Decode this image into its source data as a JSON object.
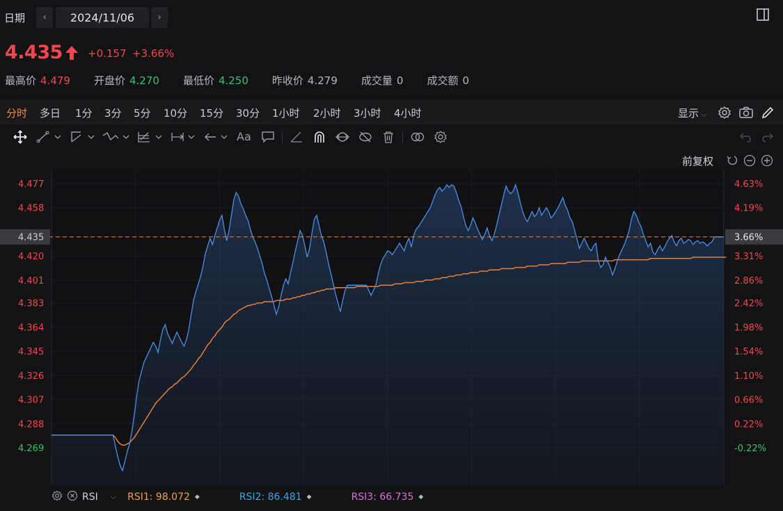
{
  "header": {
    "date_label": "日期",
    "date_value": "2024/11/06",
    "prev_label": "‹",
    "next_label": "›"
  },
  "quote": {
    "price": "4.435",
    "change": "+0.157",
    "change_pct": "+3.66%",
    "stats": [
      {
        "label": "最高价",
        "value": "4.479",
        "color": "red"
      },
      {
        "label": "开盘价",
        "value": "4.270",
        "color": "green"
      },
      {
        "label": "最低价",
        "value": "4.250",
        "color": "green"
      },
      {
        "label": "昨收价",
        "value": "4.279",
        "color": "neutral"
      },
      {
        "label": "成交量",
        "value": "0",
        "color": "neutral"
      },
      {
        "label": "成交额",
        "value": "0",
        "color": "neutral"
      }
    ]
  },
  "timeframes": [
    "分时",
    "多日",
    "1分",
    "3分",
    "5分",
    "10分",
    "15分",
    "30分",
    "1小时",
    "2小时",
    "3小时",
    "4小时"
  ],
  "active_timeframe": "分时",
  "toolbar_right": {
    "display_label": "显示"
  },
  "adjust_label": "前复权",
  "rsi": {
    "name": "RSI",
    "rsi1": "RSI1: 98.072",
    "rsi2": "RSI2: 86.481",
    "rsi3": "RSI3: 66.735",
    "rsi1_color": "#f0a04a",
    "rsi2_color": "#3aa6e8",
    "rsi3_color": "#d872d8"
  },
  "colors": {
    "up": "#f0484e",
    "down": "#36c46b",
    "price_line": "#4a90e8",
    "avg_line": "#e8803a",
    "accent": "#f08a3a"
  },
  "chart_data": {
    "type": "line",
    "prev_close": 4.279,
    "current": 4.435,
    "ylim": [
      4.25,
      4.48
    ],
    "left_ticks": [
      "4.477",
      "4.458",
      "4.435",
      "4.420",
      "4.401",
      "4.383",
      "4.364",
      "4.345",
      "4.326",
      "4.307",
      "4.288",
      "4.269"
    ],
    "left_tick_values": [
      4.477,
      4.458,
      4.435,
      4.42,
      4.401,
      4.383,
      4.364,
      4.345,
      4.326,
      4.307,
      4.288,
      4.269
    ],
    "right_ticks": [
      "4.63%",
      "4.19%",
      "3.66%",
      "3.31%",
      "2.86%",
      "2.42%",
      "1.98%",
      "1.54%",
      "1.10%",
      "0.66%",
      "0.22%",
      "-0.22%"
    ],
    "highlight_value": "4.435",
    "highlight_pct": "3.66%",
    "series": [
      {
        "name": "price",
        "values": [
          4.279,
          4.279,
          4.279,
          4.279,
          4.279,
          4.279,
          4.279,
          4.279,
          4.279,
          4.279,
          4.279,
          4.279,
          4.279,
          4.279,
          4.279,
          4.279,
          4.279,
          4.279,
          4.279,
          4.279,
          4.279,
          4.279,
          4.279,
          4.279,
          4.279,
          4.279,
          4.279,
          4.27,
          4.262,
          4.255,
          4.251,
          4.258,
          4.266,
          4.272,
          4.282,
          4.295,
          4.31,
          4.322,
          4.329,
          4.336,
          4.34,
          4.344,
          4.348,
          4.352,
          4.349,
          4.344,
          4.354,
          4.362,
          4.366,
          4.359,
          4.355,
          4.351,
          4.356,
          4.36,
          4.356,
          4.352,
          4.349,
          4.354,
          4.362,
          4.374,
          4.385,
          4.392,
          4.398,
          4.404,
          4.412,
          4.422,
          4.428,
          4.434,
          4.429,
          4.436,
          4.442,
          4.448,
          4.452,
          4.441,
          4.432,
          4.44,
          4.452,
          4.464,
          4.47,
          4.467,
          4.461,
          4.457,
          4.452,
          4.448,
          4.441,
          4.435,
          4.431,
          4.426,
          4.42,
          4.414,
          4.406,
          4.401,
          4.394,
          4.388,
          4.381,
          4.374,
          4.38,
          4.389,
          4.397,
          4.402,
          4.398,
          4.407,
          4.415,
          4.424,
          4.432,
          4.44,
          4.436,
          4.428,
          4.419,
          4.426,
          4.438,
          4.449,
          4.452,
          4.444,
          4.436,
          4.431,
          4.423,
          4.414,
          4.406,
          4.398,
          4.39,
          4.383,
          4.376,
          4.385,
          4.393,
          4.397,
          4.397,
          4.397,
          4.397,
          4.397,
          4.397,
          4.397,
          4.397,
          4.397,
          4.393,
          4.389,
          4.393,
          4.397,
          4.406,
          4.413,
          4.418,
          4.421,
          4.424,
          4.423,
          4.421,
          4.424,
          4.427,
          4.43,
          4.427,
          4.424,
          4.43,
          4.434,
          4.427,
          4.436,
          4.441,
          4.443,
          4.446,
          4.449,
          4.452,
          4.455,
          4.458,
          4.463,
          4.468,
          4.472,
          4.474,
          4.471,
          4.473,
          4.476,
          4.474,
          4.476,
          4.475,
          4.47,
          4.464,
          4.459,
          4.451,
          4.444,
          4.44,
          4.444,
          4.45,
          4.446,
          4.441,
          4.437,
          4.433,
          4.437,
          4.442,
          4.436,
          4.432,
          4.437,
          4.444,
          4.452,
          4.46,
          4.468,
          4.475,
          4.471,
          4.469,
          4.471,
          4.476,
          4.47,
          4.462,
          4.455,
          4.45,
          4.447,
          4.451,
          4.455,
          4.451,
          4.453,
          4.458,
          4.452,
          4.455,
          4.458,
          4.455,
          4.45,
          4.452,
          4.455,
          4.458,
          4.462,
          4.466,
          4.46,
          4.456,
          4.45,
          4.447,
          4.44,
          4.433,
          4.426,
          4.43,
          4.434,
          4.43,
          4.426,
          4.424,
          4.428,
          4.43,
          4.416,
          4.411,
          4.413,
          4.419,
          4.415,
          4.411,
          4.405,
          4.41,
          4.416,
          4.421,
          4.425,
          4.429,
          4.434,
          4.44,
          4.449,
          4.455,
          4.452,
          4.447,
          4.443,
          4.437,
          4.432,
          4.427,
          4.43,
          4.423,
          4.421,
          4.425,
          4.428,
          4.424,
          4.427,
          4.431,
          4.434,
          4.436,
          4.431,
          4.428,
          4.432,
          4.434,
          4.43,
          4.431,
          4.433,
          4.432,
          4.429,
          4.431,
          4.432,
          4.43,
          4.431,
          4.43,
          4.428,
          4.43,
          4.431,
          4.435,
          4.435,
          4.435,
          4.435,
          4.435
        ]
      },
      {
        "name": "avg",
        "values": [
          4.279,
          4.279,
          4.279,
          4.279,
          4.279,
          4.279,
          4.279,
          4.279,
          4.279,
          4.279,
          4.279,
          4.279,
          4.279,
          4.279,
          4.279,
          4.279,
          4.279,
          4.279,
          4.279,
          4.279,
          4.279,
          4.279,
          4.279,
          4.279,
          4.279,
          4.279,
          4.279,
          4.277,
          4.274,
          4.272,
          4.271,
          4.271,
          4.272,
          4.273,
          4.275,
          4.277,
          4.28,
          4.283,
          4.286,
          4.289,
          4.292,
          4.295,
          4.298,
          4.301,
          4.304,
          4.306,
          4.308,
          4.31,
          4.312,
          4.314,
          4.316,
          4.317,
          4.319,
          4.32,
          4.322,
          4.324,
          4.325,
          4.327,
          4.329,
          4.331,
          4.334,
          4.336,
          4.339,
          4.341,
          4.344,
          4.347,
          4.35,
          4.352,
          4.355,
          4.357,
          4.36,
          4.362,
          4.364,
          4.367,
          4.369,
          4.37,
          4.372,
          4.374,
          4.375,
          4.377,
          4.378,
          4.379,
          4.38,
          4.381,
          4.381,
          4.382,
          4.382,
          4.383,
          4.383,
          4.383,
          4.384,
          4.384,
          4.384,
          4.384,
          4.384,
          4.385,
          4.385,
          4.385,
          4.385,
          4.386,
          4.386,
          4.386,
          4.387,
          4.387,
          4.388,
          4.388,
          4.389,
          4.389,
          4.39,
          4.39,
          4.391,
          4.391,
          4.392,
          4.392,
          4.393,
          4.393,
          4.394,
          4.394,
          4.394,
          4.394,
          4.395,
          4.395,
          4.395,
          4.395,
          4.395,
          4.395,
          4.395,
          4.395,
          4.395,
          4.396,
          4.396,
          4.396,
          4.396,
          4.396,
          4.396,
          4.396,
          4.396,
          4.396,
          4.396,
          4.397,
          4.397,
          4.397,
          4.397,
          4.397,
          4.397,
          4.398,
          4.398,
          4.398,
          4.398,
          4.399,
          4.399,
          4.399,
          4.399,
          4.399,
          4.4,
          4.4,
          4.4,
          4.4,
          4.401,
          4.401,
          4.401,
          4.401,
          4.402,
          4.402,
          4.402,
          4.403,
          4.403,
          4.403,
          4.404,
          4.404,
          4.404,
          4.405,
          4.405,
          4.405,
          4.406,
          4.406,
          4.406,
          4.407,
          4.407,
          4.407,
          4.407,
          4.408,
          4.408,
          4.408,
          4.408,
          4.409,
          4.409,
          4.409,
          4.409,
          4.409,
          4.41,
          4.41,
          4.41,
          4.41,
          4.41,
          4.41,
          4.411,
          4.411,
          4.411,
          4.411,
          4.411,
          4.412,
          4.412,
          4.412,
          4.412,
          4.412,
          4.413,
          4.413,
          4.413,
          4.413,
          4.413,
          4.414,
          4.414,
          4.414,
          4.414,
          4.414,
          4.414,
          4.414,
          4.415,
          4.415,
          4.415,
          4.415,
          4.415,
          4.415,
          4.416,
          4.416,
          4.416,
          4.416,
          4.416,
          4.416,
          4.416,
          4.416,
          4.416,
          4.416,
          4.416,
          4.416,
          4.416,
          4.416,
          4.417,
          4.417,
          4.417,
          4.417,
          4.417,
          4.417,
          4.417,
          4.417,
          4.417,
          4.417,
          4.417,
          4.417,
          4.417,
          4.417,
          4.417,
          4.418,
          4.418,
          4.418,
          4.418,
          4.418,
          4.418,
          4.418,
          4.418,
          4.418,
          4.418,
          4.418,
          4.418,
          4.418,
          4.418,
          4.418,
          4.418,
          4.418,
          4.418,
          4.419,
          4.419,
          4.419,
          4.419,
          4.419,
          4.419,
          4.419,
          4.419,
          4.419,
          4.419,
          4.419,
          4.419,
          4.419,
          4.419,
          4.419
        ]
      }
    ]
  }
}
